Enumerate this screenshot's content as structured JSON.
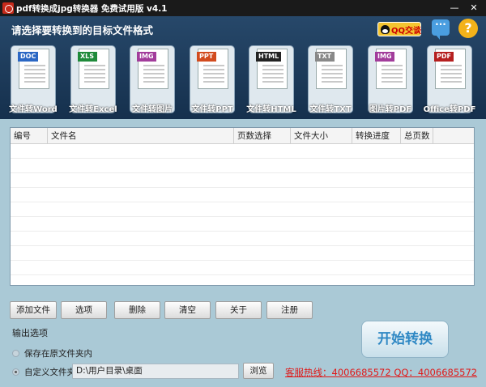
{
  "window": {
    "title": "pdf转换成jpg转换器 免费试用版 v4.1",
    "minimize_glyph": "—",
    "close_glyph": "✕"
  },
  "header": {
    "heading": "请选择要转换到的目标文件格式",
    "qq_button": "QQ交谈",
    "chat_glyph": "···",
    "help_glyph": "?"
  },
  "formats": [
    {
      "tag": "DOC",
      "label": "文件转Word"
    },
    {
      "tag": "XLS",
      "label": "文件转Excel"
    },
    {
      "tag": "IMG",
      "label": "文件转图片"
    },
    {
      "tag": "PPT",
      "label": "文件转PPT"
    },
    {
      "tag": "HTML",
      "label": "文件转HTML"
    },
    {
      "tag": "TXT",
      "label": "文件转TXT"
    },
    {
      "tag": "IMG",
      "label": "图片转PDF"
    },
    {
      "tag": "PDF",
      "label": "Office转PDF"
    }
  ],
  "table": {
    "columns": [
      "编号",
      "文件名",
      "页数选择",
      "文件大小",
      "转换进度",
      "总页数"
    ],
    "rows": []
  },
  "actions": {
    "add_file": "添加文件",
    "options": "选项",
    "delete": "删除",
    "clear": "清空",
    "about": "关于",
    "register": "注册"
  },
  "output": {
    "section_label": "输出选项",
    "option_original": "保存在原文件夹内",
    "option_custom": "自定义文件夹",
    "custom_path": "D:\\用户目录\\桌面",
    "browse": "浏览"
  },
  "start_button": "开始转换",
  "hotline": "客服热线：4006685572 QQ：4006685572"
}
